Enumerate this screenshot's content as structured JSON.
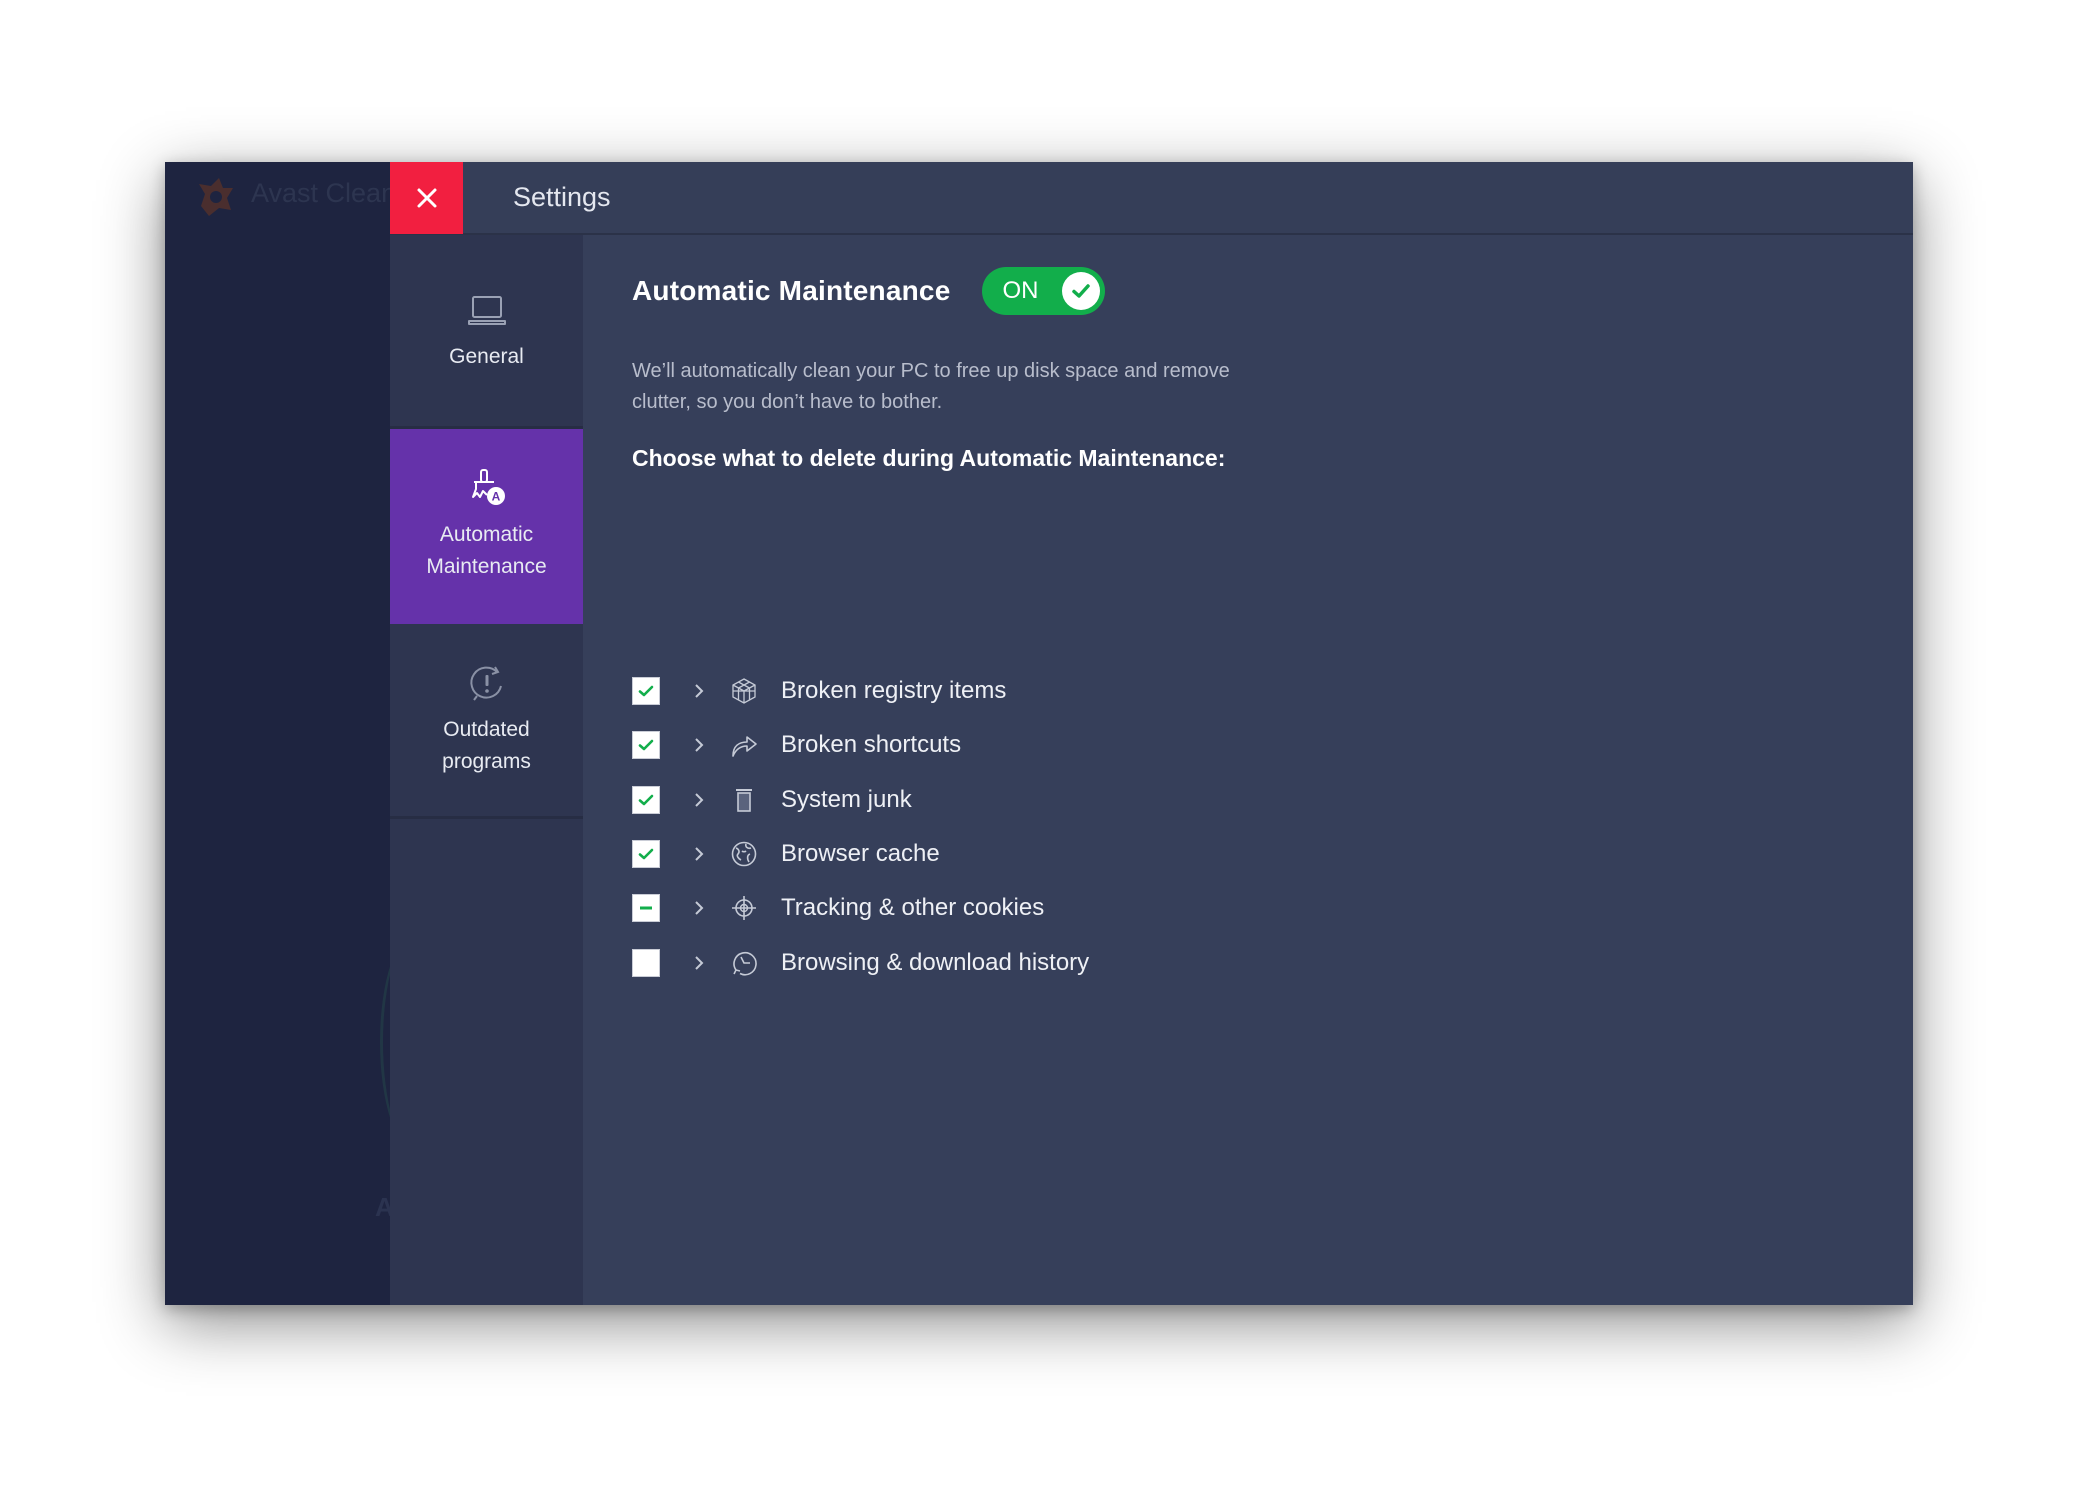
{
  "background_app": {
    "title": "Avast Clean",
    "partial_letter": "A"
  },
  "window": {
    "title": "Settings",
    "close_icon": "close-icon"
  },
  "nav": {
    "items": [
      {
        "label": "General",
        "icon": "laptop-icon",
        "active": false
      },
      {
        "label": "Automatic Maintenance",
        "icon": "brush-auto-icon",
        "active": true
      },
      {
        "label": "Outdated programs",
        "icon": "update-alert-icon",
        "active": false
      }
    ]
  },
  "main": {
    "heading": "Automatic Maintenance",
    "toggle": {
      "label": "ON",
      "state": "on",
      "color": "#12ae4b"
    },
    "description": "We’ll automatically clean your PC to free up disk space and remove clutter, so you don’t have to bother.",
    "subheading": "Choose what to delete during Automatic Maintenance:",
    "items": [
      {
        "label": "Broken registry items",
        "icon": "registry-cube-icon",
        "state": "checked"
      },
      {
        "label": "Broken shortcuts",
        "icon": "shortcut-arrow-icon",
        "state": "checked"
      },
      {
        "label": "System junk",
        "icon": "trash-icon",
        "state": "checked"
      },
      {
        "label": "Browser cache",
        "icon": "globe-icon",
        "state": "checked"
      },
      {
        "label": "Tracking & other cookies",
        "icon": "crosshair-icon",
        "state": "partial"
      },
      {
        "label": "Browsing & download history",
        "icon": "history-clock-icon",
        "state": "unchecked"
      }
    ]
  },
  "colors": {
    "accent_purple": "#6532aa",
    "close_red": "#f21f40",
    "check_green": "#12ae4b"
  }
}
